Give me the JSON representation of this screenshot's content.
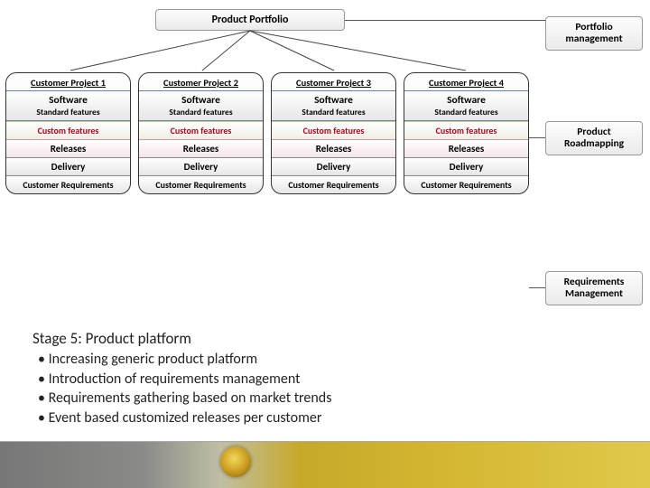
{
  "header": {
    "portfolio_label": "Product Portfolio"
  },
  "side": {
    "portfolio_mgmt": "Portfolio management",
    "roadmapping": "Product Roadmapping",
    "req_mgmt": "Requirements Management"
  },
  "projects": [
    {
      "title": "Customer Project 1",
      "software": "Software",
      "std": "Standard features",
      "custom": "Custom features",
      "releases": "Releases",
      "delivery": "Delivery",
      "requirements": "Customer Requirements"
    },
    {
      "title": "Customer Project 2",
      "software": "Software",
      "std": "Standard features",
      "custom": "Custom features",
      "releases": "Releases",
      "delivery": "Delivery",
      "requirements": "Customer Requirements"
    },
    {
      "title": "Customer Project 3",
      "software": "Software",
      "std": "Standard features",
      "custom": "Custom features",
      "releases": "Releases",
      "delivery": "Delivery",
      "requirements": "Customer Requirements"
    },
    {
      "title": "Customer Project 4",
      "software": "Software",
      "std": "Standard features",
      "custom": "Custom features",
      "releases": "Releases",
      "delivery": "Delivery",
      "requirements": "Customer Requirements"
    }
  ],
  "stage": {
    "title": "Stage 5: Product platform",
    "bullets": [
      "Increasing generic product platform",
      "Introduction of requirements management",
      "Requirements gathering based on market trends",
      "Event based customized releases per customer"
    ]
  }
}
